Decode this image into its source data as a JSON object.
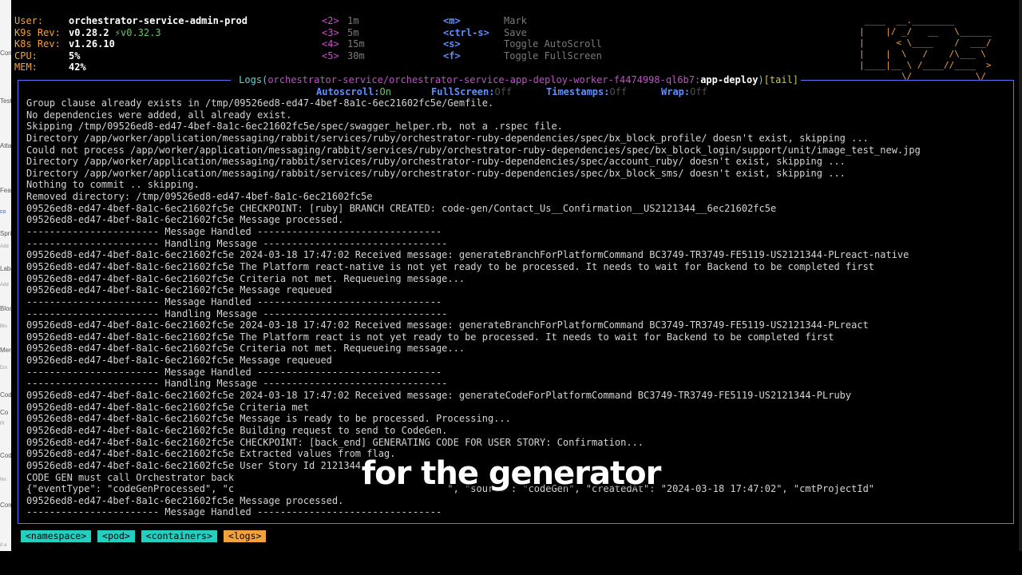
{
  "side_strip": [
    "Con",
    "Test",
    "Atta",
    "Feat",
    "co",
    "Spri",
    "Add",
    "Labe",
    "Add",
    "Bloc",
    "Blo",
    "Merg",
    "Ent",
    "Code",
    "Co",
    "Pl",
    "Code",
    "No",
    "Com",
    "d a"
  ],
  "header": {
    "info": [
      {
        "label": "User:",
        "value": "orchestrator-service-admin-prod"
      },
      {
        "label": "K9s Rev:",
        "value": "v0.28.2",
        "extra": "⚡v0.32.3"
      },
      {
        "label": "K8s Rev:",
        "value": "v1.26.10"
      },
      {
        "label": "CPU:",
        "value": "5%"
      },
      {
        "label": "MEM:",
        "value": "42%"
      }
    ],
    "shortcuts_col1": [
      {
        "key": "<2>",
        "desc": "1m"
      },
      {
        "key": "<3>",
        "desc": "5m"
      },
      {
        "key": "<4>",
        "desc": "15m"
      },
      {
        "key": "<5>",
        "desc": "30m"
      }
    ],
    "shortcuts_col2": [
      {
        "key": "<m>",
        "desc": "Mark"
      },
      {
        "key": "<ctrl-s>",
        "desc": "Save"
      },
      {
        "key": "<s>",
        "desc": "Toggle AutoScroll"
      },
      {
        "key": "<f>",
        "desc": "Toggle FullScreen"
      }
    ],
    "logo": " ____  __.________        \n|    |/ _/   __   \\______ \n|      < \\____    /  ___/ \n|    |  \\   /    /\\___ \\  \n|____|__ \\ /____//____  > \n        \\/            \\/  "
  },
  "logs": {
    "title_prefix": " Logs(",
    "namespace": "orchestrator-service",
    "slash": "/",
    "pod": "orchestrator-service-app-deploy-worker-f4474998-ql6b7",
    "colon": ":",
    "container": "app-deploy",
    "close_paren": ")",
    "mode": "[tail]",
    "status": {
      "autoscroll_label": "Autoscroll:",
      "autoscroll_value": "On",
      "fullscreen_label": "FullScreen:",
      "fullscreen_value": "Off",
      "timestamps_label": "Timestamps:",
      "timestamps_value": "Off",
      "wrap_label": "Wrap:",
      "wrap_value": "Off"
    },
    "lines": [
      "Group clause already exists in /tmp/09526ed8-ed47-4bef-8a1c-6ec21602fc5e/Gemfile.",
      "No dependencies were added, all already exist.",
      "Skipping /tmp/09526ed8-ed47-4bef-8a1c-6ec21602fc5e/spec/swagger_helper.rb, not a .rspec file.",
      "Directory /app/worker/application/messaging/rabbit/services/ruby/orchestrator-ruby-dependencies/spec/bx_block_profile/ doesn't exist, skipping ...",
      "Could not process /app/worker/application/messaging/rabbit/services/ruby/orchestrator-ruby-dependencies/spec/bx_block_login/support/unit/image_test_new.jpg",
      "Directory /app/worker/application/messaging/rabbit/services/ruby/orchestrator-ruby-dependencies/spec/account_ruby/ doesn't exist, skipping ...",
      "Directory /app/worker/application/messaging/rabbit/services/ruby/orchestrator-ruby-dependencies/spec/bx_block_sms/ doesn't exist, skipping ...",
      "Nothing to commit .. skipping.",
      "Removed directory: /tmp/09526ed8-ed47-4bef-8a1c-6ec21602fc5e",
      "09526ed8-ed47-4bef-8a1c-6ec21602fc5e CHECKPOINT: [ruby] BRANCH CREATED: code-gen/Contact_Us__Confirmation__US2121344__6ec21602fc5e",
      "09526ed8-ed47-4bef-8a1c-6ec21602fc5e Message processed.",
      "----------------------- Message Handled --------------------------------",
      "----------------------- Handling Message --------------------------------",
      "09526ed8-ed47-4bef-8a1c-6ec21602fc5e 2024-03-18 17:47:02 Received message: generateBranchForPlatformCommand BC3749-TR3749-FE5119-US2121344-PLreact-native",
      "09526ed8-ed47-4bef-8a1c-6ec21602fc5e The Platform react-native is not yet ready to be processed. It needs to wait for Backend to be completed first",
      "09526ed8-ed47-4bef-8a1c-6ec21602fc5e Criteria not met. Requeueing message...",
      "09526ed8-ed47-4bef-8a1c-6ec21602fc5e Message requeued",
      "----------------------- Message Handled --------------------------------",
      "----------------------- Handling Message --------------------------------",
      "09526ed8-ed47-4bef-8a1c-6ec21602fc5e 2024-03-18 17:47:02 Received message: generateBranchForPlatformCommand BC3749-TR3749-FE5119-US2121344-PLreact",
      "09526ed8-ed47-4bef-8a1c-6ec21602fc5e The Platform react is not yet ready to be processed. It needs to wait for Backend to be completed first",
      "09526ed8-ed47-4bef-8a1c-6ec21602fc5e Criteria not met. Requeueing message...",
      "09526ed8-ed47-4bef-8a1c-6ec21602fc5e Message requeued",
      "----------------------- Message Handled --------------------------------",
      "----------------------- Handling Message --------------------------------",
      "09526ed8-ed47-4bef-8a1c-6ec21602fc5e 2024-03-18 17:47:02 Received message: generateCodeForPlatformCommand BC3749-TR3749-FE5119-US2121344-PLruby",
      "09526ed8-ed47-4bef-8a1c-6ec21602fc5e Criteria met",
      "09526ed8-ed47-4bef-8a1c-6ec21602fc5e Message is ready to be processed. Processing...",
      "09526ed8-ed47-4bef-8a1c-6ec21602fc5e Building request to send to CodeGen.",
      "09526ed8-ed47-4bef-8a1c-6ec21602fc5e CHECKPOINT: [back_end] GENERATING CODE FOR USER STORY: Confirmation...",
      "09526ed8-ed47-4bef-8a1c-6ec21602fc5e Extracted values from flag.",
      "09526ed8-ed47-4bef-8a1c-6ec21602fc5e User Story Id 2121344",
      "CODE GEN must call Orchestrator back",
      "{\"eventType\": \"codeGenProcessed\", \"c                                     \", \"source\": \"codeGen\", \"createdAt\": \"2024-03-18 17:47:02\", \"cmtProjectId\"",
      "09526ed8-ed47-4bef-8a1c-6ec21602fc5e Message processed.",
      "----------------------- Message Handled --------------------------------"
    ]
  },
  "caption": "for the generator",
  "breadcrumbs": [
    {
      "label": "<namespace>",
      "color": "#22cfc0"
    },
    {
      "label": "<pod>",
      "color": "#22cfc0"
    },
    {
      "label": "<containers>",
      "color": "#22cfc0"
    },
    {
      "label": "<logs>",
      "color": "#f2a23c"
    }
  ]
}
